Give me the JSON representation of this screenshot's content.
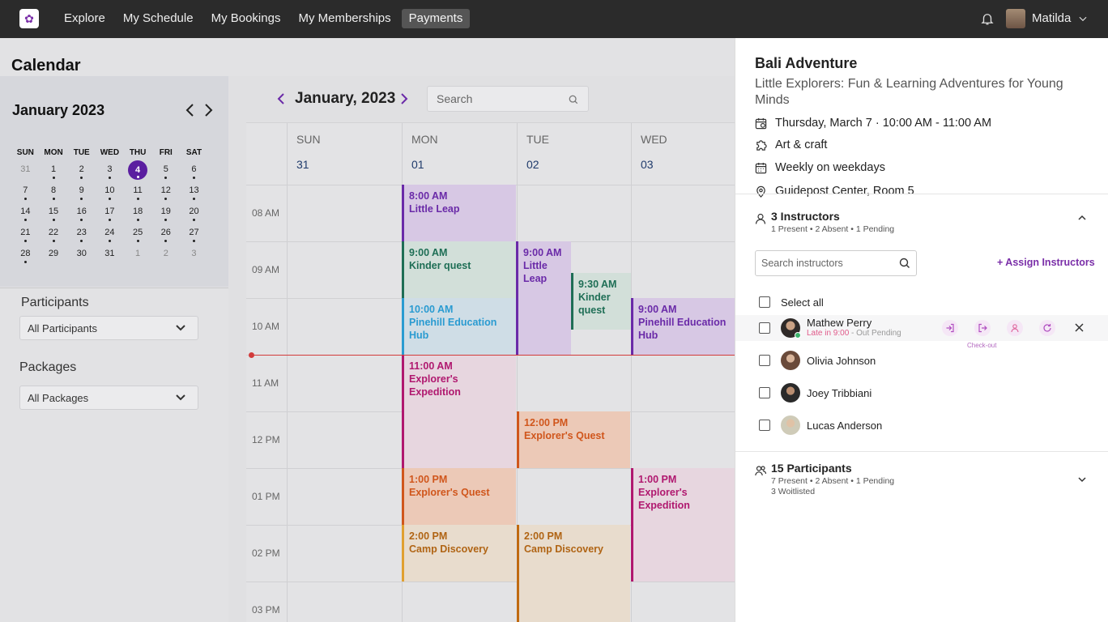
{
  "topbar": {
    "nav": [
      "Explore",
      "My Schedule",
      "My Bookings",
      "My Memberships",
      "Payments"
    ],
    "active_nav": "Payments",
    "user_name": "Matilda"
  },
  "sidebar": {
    "title": "Calendar",
    "mini_calendar": {
      "month_label": "January 2023",
      "weekdays": [
        "SUN",
        "MON",
        "TUE",
        "WED",
        "THU",
        "FRI",
        "SAT"
      ],
      "weeks": [
        [
          "31",
          "1",
          "2",
          "3",
          "4",
          "5",
          "6"
        ],
        [
          "7",
          "8",
          "9",
          "10",
          "11",
          "12",
          "13"
        ],
        [
          "14",
          "15",
          "16",
          "17",
          "18",
          "19",
          "20"
        ],
        [
          "21",
          "22",
          "23",
          "24",
          "25",
          "26",
          "27"
        ],
        [
          "28",
          "29",
          "30",
          "31",
          "1",
          "2",
          "3"
        ]
      ],
      "selected": "4"
    },
    "participants_label": "Participants",
    "participants_value": "All Participants",
    "packages_label": "Packages",
    "packages_value": "All Packages"
  },
  "calendar": {
    "month_label": "January, 2023",
    "search_placeholder": "Search",
    "days": [
      {
        "name": "SUN",
        "num": "31"
      },
      {
        "name": "MON",
        "num": "01"
      },
      {
        "name": "TUE",
        "num": "02"
      },
      {
        "name": "WED",
        "num": "03"
      }
    ],
    "times": [
      "08 AM",
      "09 AM",
      "10 AM",
      "11 AM",
      "12 PM",
      "01 PM",
      "02 PM",
      "03 PM"
    ],
    "events": [
      {
        "time": "8:00 AM",
        "title": "Little Leap"
      },
      {
        "time": "9:00 AM",
        "title": "Kinder quest"
      },
      {
        "time": "10:00 AM",
        "title": "Pinehill Education Hub"
      },
      {
        "time": "11:00 AM",
        "title": "Explorer's Expedition"
      },
      {
        "time": "1:00 PM",
        "title": "Explorer's Quest"
      },
      {
        "time": "2:00 PM",
        "title": "Camp Discovery"
      },
      {
        "time": "9:00 AM",
        "title": "Little Leap"
      },
      {
        "time": "9:30 AM",
        "title": "Kinder quest"
      },
      {
        "time": "12:00 PM",
        "title": "Explorer's Quest"
      },
      {
        "time": "2:00 PM",
        "title": "Camp Discovery"
      },
      {
        "time": "9:00 AM",
        "title": "Pinehill Education Hub"
      },
      {
        "time": "1:00 PM",
        "title": "Explorer's Expedition"
      }
    ],
    "colors": {
      "purple": "#6a2aa8",
      "green": "#1e6e55",
      "blue": "#2a9bd1",
      "magenta": "#b0186f",
      "orange": "#d0561c",
      "amber": "#c06a10",
      "now_line": "#d23b3b"
    }
  },
  "panel": {
    "title": "Bali Adventure",
    "subtitle": "Little Explorers: Fun & Learning Adventures for Young Minds",
    "datetime": "Thursday, March 7 · 10:00 AM - 11:00 AM",
    "category": "Art & craft",
    "recurrence": "Weekly on weekdays",
    "location": "Guidepost Center, Room 5",
    "instructors": {
      "title": "3 Instructors",
      "summary": "1 Present • 2 Absent • 1 Pending",
      "search_placeholder": "Search instructors",
      "assign_label": "+ Assign Instructors",
      "select_all": "Select all",
      "list": [
        {
          "name": "Mathew Perry"
        },
        {
          "name": "Olivia Johnson"
        },
        {
          "name": "Joey Tribbiani"
        },
        {
          "name": "Lucas Anderson"
        }
      ],
      "late_status": "Late in 9:00",
      "out_status": " - Out Pending",
      "checkout_tooltip": "Check-out"
    },
    "participants": {
      "title": "15 Participants",
      "summary": "7 Present • 2 Absent • 1 Pending",
      "waitlist": "3 Woitlisted"
    }
  }
}
